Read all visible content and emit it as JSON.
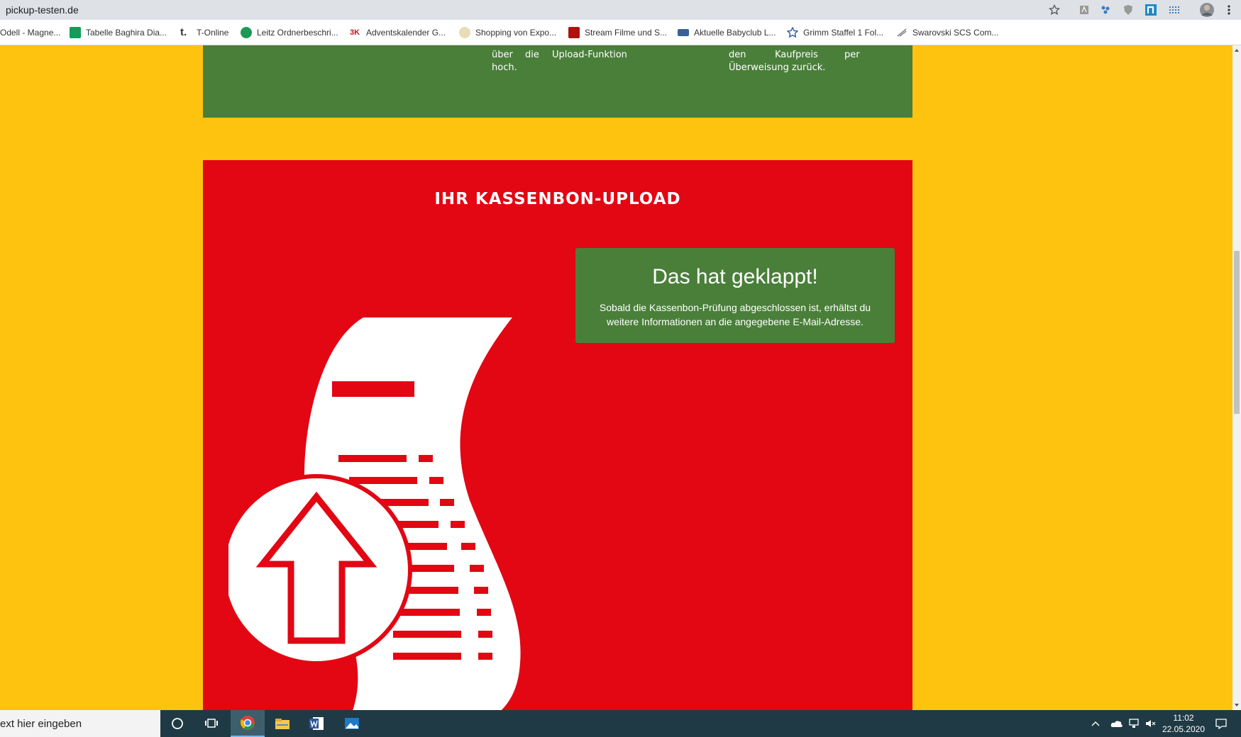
{
  "browser": {
    "url": "pickup-testen.de",
    "bookmarks": [
      {
        "label": "Odell - Magne...",
        "icon": "bookmark-page-icon",
        "color": "#888888"
      },
      {
        "label": "Tabelle Baghira Dia...",
        "icon": "sheets-icon",
        "color": "#0f9d58"
      },
      {
        "label": "T-Online",
        "icon": "t-online-icon",
        "color": "#333333"
      },
      {
        "label": "Leitz Ordnerbeschri...",
        "icon": "leitz-icon",
        "color": "#1a9a55"
      },
      {
        "label": "Adventskalender G...",
        "icon": "advent-icon",
        "color": "#c0141d"
      },
      {
        "label": "Shopping von Expo...",
        "icon": "shopping-icon",
        "color": "#d9c9a0"
      },
      {
        "label": "Stream Filme und S...",
        "icon": "stream-icon",
        "color": "#b01010"
      },
      {
        "label": "Aktuelle Babyclub L...",
        "icon": "babyclub-icon",
        "color": "#3a5f9a"
      },
      {
        "label": "Grimm Staffel 1 Fol...",
        "icon": "star-icon",
        "color": "#2a5aa8"
      },
      {
        "label": "Swarovski SCS Com...",
        "icon": "swarovski-icon",
        "color": "#888888"
      }
    ]
  },
  "green_band": {
    "col1_line1_a": "über",
    "col1_line1_b": "die",
    "col1_line1_c": "Upload-Funktion",
    "col1_line2": "hoch.",
    "col2_line1_a": "den",
    "col2_line1_b": "Kaufpreis",
    "col2_line1_c": "per",
    "col2_line2": "Überweisung zurück."
  },
  "upload_section": {
    "title": "IHR KASSENBON-UPLOAD",
    "success_title": "Das hat geklappt!",
    "success_text": "Sobald die Kassenbon-Prüfung abgeschlossen ist, erhältst du weitere Informationen an die angegebene E-Mail-Adresse."
  },
  "taskbar": {
    "search_text": "ext hier eingeben",
    "time": "11:02",
    "date": "22.05.2020"
  },
  "colors": {
    "page_bg": "#fdc30f",
    "green": "#4a7f3a",
    "red": "#e30613"
  }
}
